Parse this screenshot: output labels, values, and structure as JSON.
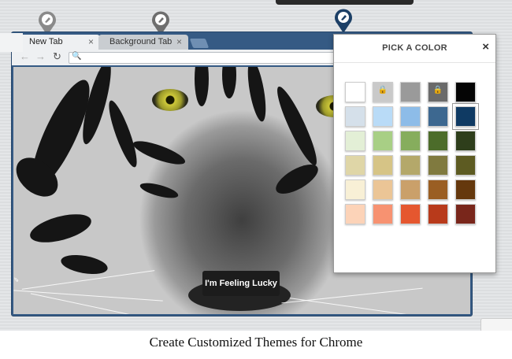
{
  "browser": {
    "tabs": [
      {
        "label": "New Tab",
        "close": "×",
        "active": true
      },
      {
        "label": "Background Tab",
        "close": "×",
        "active": false
      }
    ],
    "lucky_button": "I'm Feeling Lucky"
  },
  "picker": {
    "title": "PICK A COLOR",
    "close": "×",
    "lock_glyph": "🔒",
    "swatches": [
      [
        "#ffffff",
        "#c9c9c9",
        "#9a9a9a",
        "#6a6a6a",
        "#050505"
      ],
      [
        "#d5e0ea",
        "#b9dbf7",
        "#8dbce8",
        "#3d6890",
        "#0f3a63"
      ],
      [
        "#e3efd6",
        "#a8cf85",
        "#86ad5d",
        "#4c6c2a",
        "#2e3e1b"
      ],
      [
        "#dfd6a7",
        "#d6c486",
        "#b4a86a",
        "#807a3f",
        "#5d5b22"
      ],
      [
        "#f8f0d6",
        "#ebc596",
        "#caa06a",
        "#9a5e23",
        "#65380d"
      ],
      [
        "#fcd3b8",
        "#f79271",
        "#e5572f",
        "#b83a1b",
        "#79261b"
      ]
    ],
    "locked": [
      [
        0,
        1
      ],
      [
        0,
        3
      ]
    ],
    "selected": [
      1,
      4
    ]
  },
  "caption": "Create Customized Themes for Chrome",
  "colors": {
    "frame": "#355a84",
    "pin_active": "#1c3f66",
    "pin_inactive": "#7f7f7f"
  }
}
